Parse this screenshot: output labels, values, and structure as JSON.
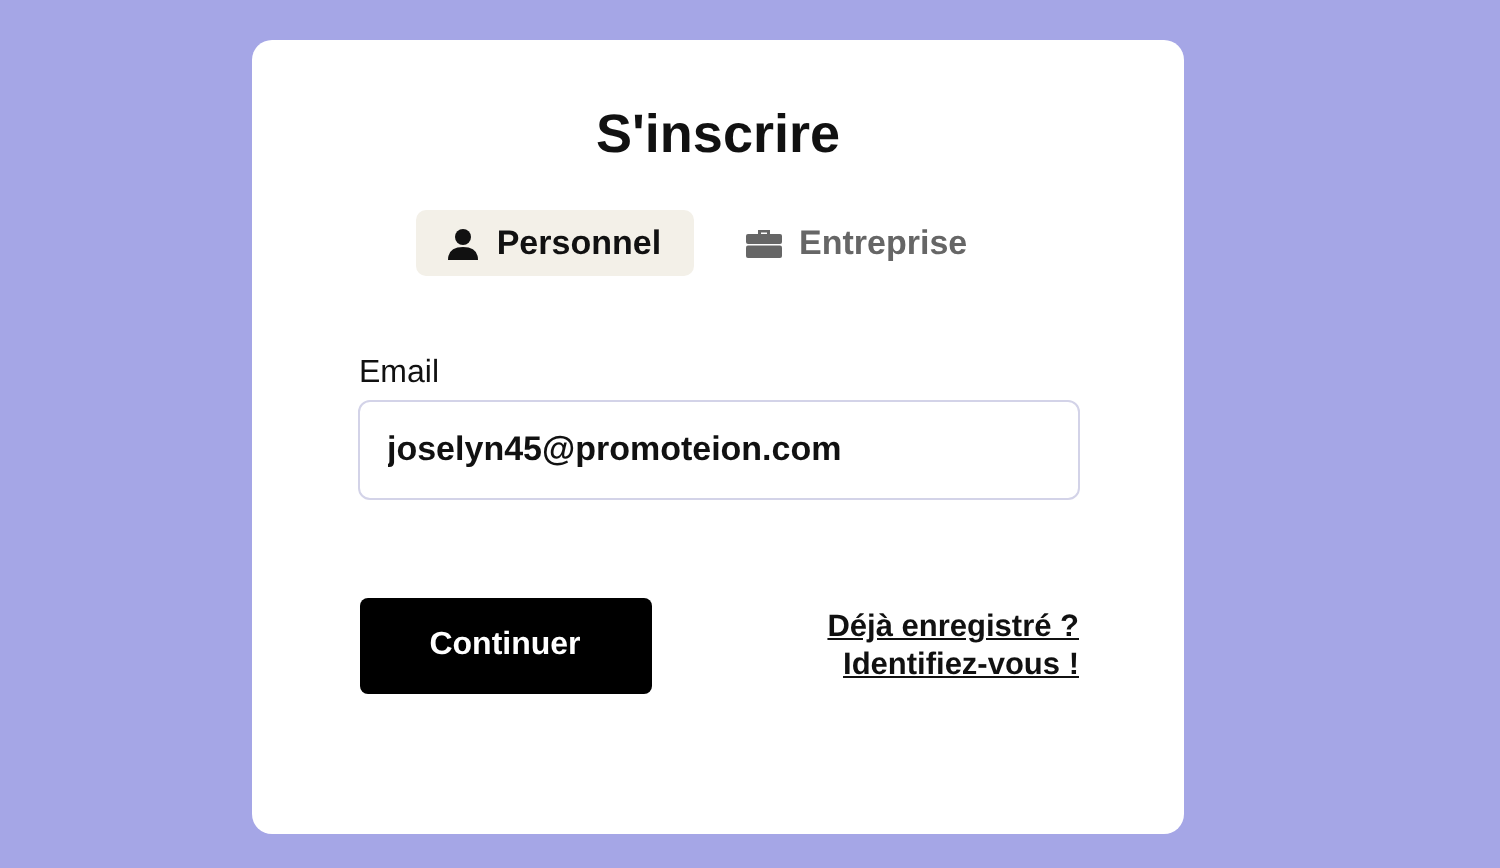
{
  "title": "S'inscrire",
  "tabs": [
    {
      "label": "Personnel",
      "kind": "person",
      "selected": true
    },
    {
      "label": "Entreprise",
      "kind": "briefcase",
      "selected": false
    }
  ],
  "email": {
    "label": "Email",
    "value": "joselyn45@promoteion.com"
  },
  "button": "Continuer",
  "login_links": [
    "Déjà enregistré ?",
    "Identifiez-vous !"
  ]
}
